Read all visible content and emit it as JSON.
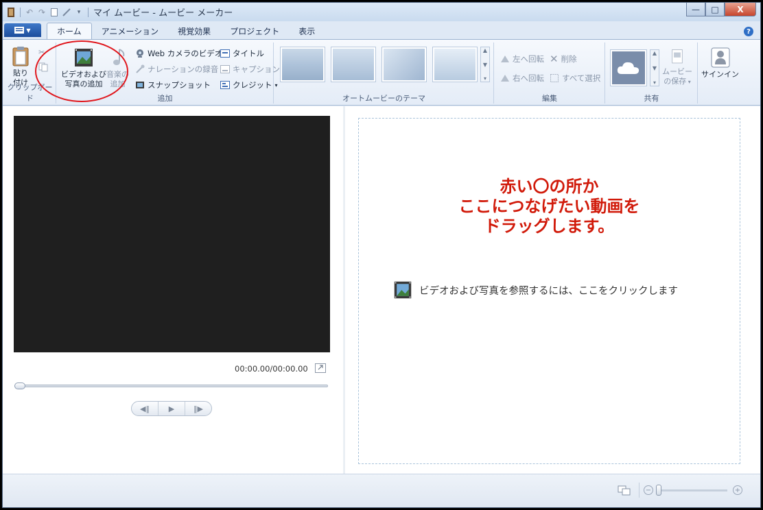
{
  "window": {
    "title": "マイ ムービー - ムービー メーカー",
    "buttons": {
      "minimize": "—",
      "maximize": "□",
      "close": "X"
    }
  },
  "tabs": [
    {
      "label": "ホーム",
      "active": true
    },
    {
      "label": "アニメーション"
    },
    {
      "label": "視覚効果"
    },
    {
      "label": "プロジェクト"
    },
    {
      "label": "表示"
    }
  ],
  "ribbon": {
    "clipboard": {
      "paste_line1": "貼り",
      "paste_line2": "付け",
      "group_label": "クリップボード"
    },
    "add": {
      "add_video_line1": "ビデオおよび",
      "add_video_line2": "写真の追加",
      "add_music_line1": "音楽の",
      "add_music_line2": "追加",
      "webcam": "Web カメラのビデオ",
      "narration": "ナレーションの録音",
      "snapshot": "スナップショット",
      "title": "タイトル",
      "caption": "キャプション",
      "credits": "クレジット",
      "group_label": "追加"
    },
    "themes": {
      "group_label": "オートムービーのテーマ"
    },
    "edit": {
      "rotate_left": "左へ回転",
      "rotate_right": "右へ回転",
      "delete": "削除",
      "select_all": "すべて選択",
      "group_label": "編集"
    },
    "share": {
      "save_movie_line1": "ムービー",
      "save_movie_line2": "の保存",
      "group_label": "共有"
    },
    "signin": {
      "label": "サインイン"
    }
  },
  "player": {
    "timecode": "00:00.00/00:00.00",
    "progress": 0
  },
  "storyboard": {
    "annotation": [
      "赤い〇の所か",
      "ここにつなげたい動画を",
      "ドラッグします。"
    ],
    "browse_text": "ビデオおよび写真を参照するには、ここをクリックします"
  },
  "colors": {
    "accent": "#1d4d9c",
    "annotation": "#d11a0a",
    "highlight_circle": "#e0161c"
  }
}
